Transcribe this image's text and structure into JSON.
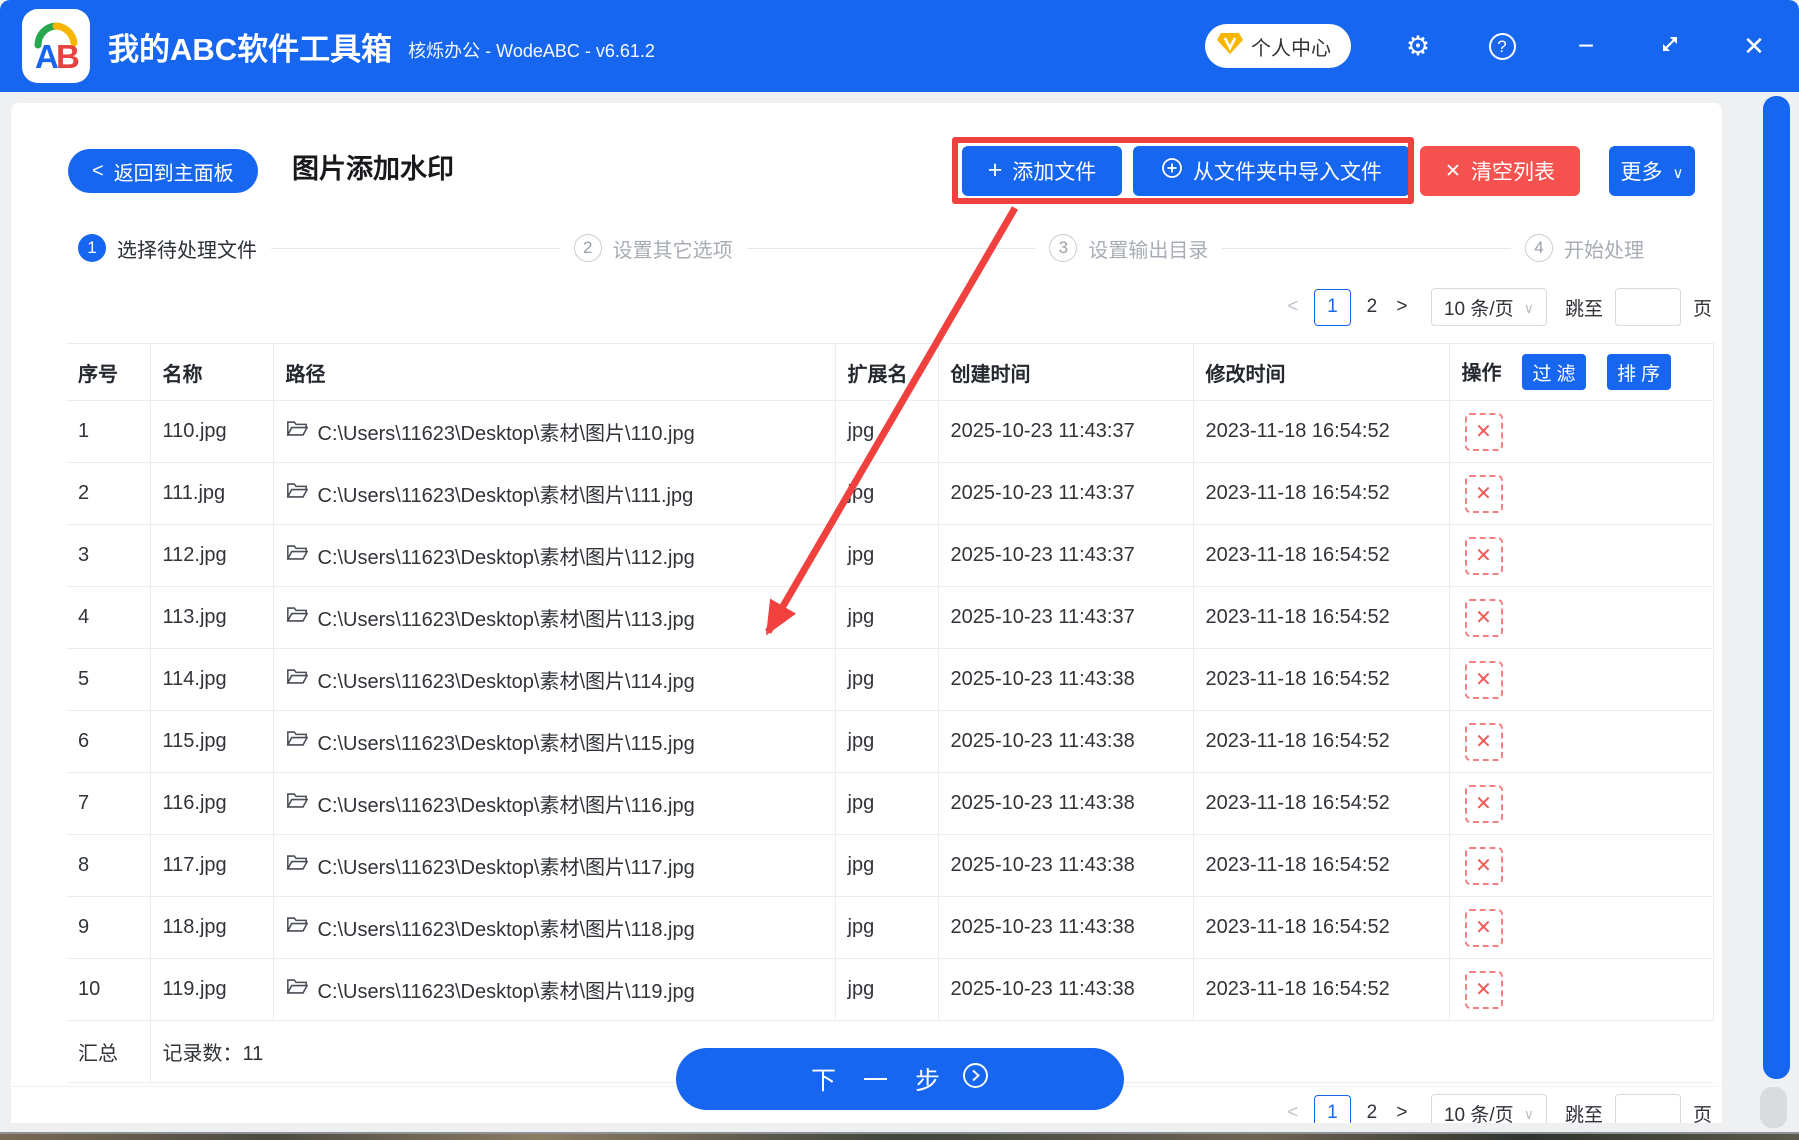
{
  "window": {
    "title": "我的ABC软件工具箱",
    "subtitle": "核烁办公 - WodeABC - v6.61.2",
    "user_center": "个人中心"
  },
  "icons": {
    "gear": "⚙",
    "help": "?",
    "minimize": "−",
    "close": "✕",
    "back_chevron": "<",
    "plus": "+",
    "clear_x": "✕",
    "chevron_down": "∨",
    "prev": "<",
    "next": ">",
    "delete": "✕"
  },
  "toolbar": {
    "back_label": "返回到主面板",
    "page_title": "图片添加水印",
    "add_files": "添加文件",
    "import_from_folder": "从文件夹中导入文件",
    "clear_list": "清空列表",
    "more": "更多"
  },
  "steps": [
    {
      "num": "1",
      "label": "选择待处理文件"
    },
    {
      "num": "2",
      "label": "设置其它选项"
    },
    {
      "num": "3",
      "label": "设置输出目录"
    },
    {
      "num": "4",
      "label": "开始处理"
    }
  ],
  "pagination": {
    "prev": "<",
    "page1": "1",
    "page2": "2",
    "next": ">",
    "page_size": "10 条/页",
    "jump_label": "跳至",
    "page_suffix": "页",
    "jump_value": ""
  },
  "table": {
    "headers": {
      "index": "序号",
      "name": "名称",
      "path": "路径",
      "ext": "扩展名",
      "created": "创建时间",
      "modified": "修改时间",
      "action": "操作"
    },
    "filter_label": "过滤",
    "sort_label": "排序",
    "rows": [
      {
        "index": "1",
        "name": "110.jpg",
        "path": "C:\\Users\\11623\\Desktop\\素材\\图片\\110.jpg",
        "ext": "jpg",
        "created": "2025-10-23 11:43:37",
        "modified": "2023-11-18 16:54:52"
      },
      {
        "index": "2",
        "name": "111.jpg",
        "path": "C:\\Users\\11623\\Desktop\\素材\\图片\\111.jpg",
        "ext": "jpg",
        "created": "2025-10-23 11:43:37",
        "modified": "2023-11-18 16:54:52"
      },
      {
        "index": "3",
        "name": "112.jpg",
        "path": "C:\\Users\\11623\\Desktop\\素材\\图片\\112.jpg",
        "ext": "jpg",
        "created": "2025-10-23 11:43:37",
        "modified": "2023-11-18 16:54:52"
      },
      {
        "index": "4",
        "name": "113.jpg",
        "path": "C:\\Users\\11623\\Desktop\\素材\\图片\\113.jpg",
        "ext": "jpg",
        "created": "2025-10-23 11:43:37",
        "modified": "2023-11-18 16:54:52"
      },
      {
        "index": "5",
        "name": "114.jpg",
        "path": "C:\\Users\\11623\\Desktop\\素材\\图片\\114.jpg",
        "ext": "jpg",
        "created": "2025-10-23 11:43:38",
        "modified": "2023-11-18 16:54:52"
      },
      {
        "index": "6",
        "name": "115.jpg",
        "path": "C:\\Users\\11623\\Desktop\\素材\\图片\\115.jpg",
        "ext": "jpg",
        "created": "2025-10-23 11:43:38",
        "modified": "2023-11-18 16:54:52"
      },
      {
        "index": "7",
        "name": "116.jpg",
        "path": "C:\\Users\\11623\\Desktop\\素材\\图片\\116.jpg",
        "ext": "jpg",
        "created": "2025-10-23 11:43:38",
        "modified": "2023-11-18 16:54:52"
      },
      {
        "index": "8",
        "name": "117.jpg",
        "path": "C:\\Users\\11623\\Desktop\\素材\\图片\\117.jpg",
        "ext": "jpg",
        "created": "2025-10-23 11:43:38",
        "modified": "2023-11-18 16:54:52"
      },
      {
        "index": "9",
        "name": "118.jpg",
        "path": "C:\\Users\\11623\\Desktop\\素材\\图片\\118.jpg",
        "ext": "jpg",
        "created": "2025-10-23 11:43:38",
        "modified": "2023-11-18 16:54:52"
      },
      {
        "index": "10",
        "name": "119.jpg",
        "path": "C:\\Users\\11623\\Desktop\\素材\\图片\\119.jpg",
        "ext": "jpg",
        "created": "2025-10-23 11:43:38",
        "modified": "2023-11-18 16:54:52"
      }
    ],
    "summary_label": "汇总",
    "summary_value": "记录数：11"
  },
  "footer": {
    "next_label": "下 一 步"
  },
  "colors": {
    "primary": "#1766f0",
    "danger": "#f4514f",
    "annotation": "#f0413f",
    "active_step": "#1766f0"
  }
}
